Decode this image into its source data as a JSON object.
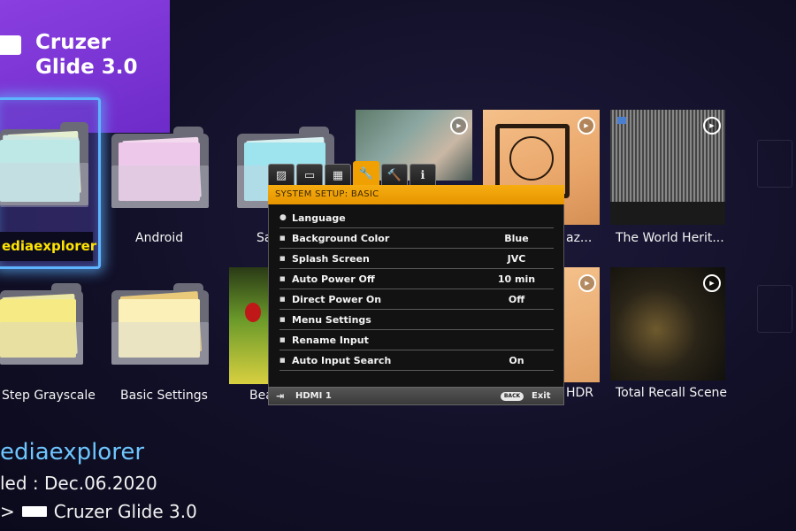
{
  "device": {
    "name": "Cruzer Glide 3.0",
    "icon": "usb-drive-icon"
  },
  "grid": {
    "folders": [
      {
        "label": "ediaexplorer",
        "selected": true,
        "sheet_colors": [
          "#e6eed0",
          "#cfe6e0",
          "#bde8e6"
        ]
      },
      {
        "label": "Android",
        "sheet_colors": [
          "#f3d9ee",
          "#eec8ea",
          "#f4e1f0"
        ]
      },
      {
        "label": "Sa",
        "sheet_colors": [
          "#d8f0f0",
          "#c2ecf0",
          "#9ee4ee"
        ]
      },
      {
        "label": "Step Grayscale",
        "sheet_colors": [
          "#ede7a6",
          "#ffe89a",
          "#f6ea85"
        ]
      },
      {
        "label": "Basic Settings",
        "sheet_colors": [
          "#e9c97a",
          "#f4e4a8",
          "#faf0b8"
        ]
      }
    ],
    "videos": [
      {
        "label": "az...",
        "icon": "play-icon"
      },
      {
        "label": "The World Herit...",
        "icon": "play-icon"
      },
      {
        "label": "Bea",
        "icon": "play-icon"
      },
      {
        "label": "HDR",
        "icon": "play-icon"
      },
      {
        "label": "Total Recall Scene",
        "icon": "play-icon"
      }
    ]
  },
  "info": {
    "title": "ediaexplorer",
    "date": "led : Dec.06.2020",
    "path_prefix": ">",
    "path_device": "Cruzer Glide 3.0"
  },
  "osd": {
    "tabs": [
      {
        "icon": "picture-icon",
        "glyph": "▨"
      },
      {
        "icon": "screen-icon",
        "glyph": "▭"
      },
      {
        "icon": "keyboard-icon",
        "glyph": "▦"
      },
      {
        "icon": "wrench-icon",
        "glyph": "🔧",
        "active": true
      },
      {
        "icon": "advanced-wrench-icon",
        "glyph": "🔨"
      },
      {
        "icon": "info-icon",
        "glyph": "ℹ"
      }
    ],
    "header": "SYSTEM SETUP: BASIC",
    "rows": [
      {
        "label": "Language",
        "value": ""
      },
      {
        "label": "Background Color",
        "value": "Blue"
      },
      {
        "label": "Splash Screen",
        "value": "JVC"
      },
      {
        "label": "Auto Power Off",
        "value": "10 min"
      },
      {
        "label": "Direct Power On",
        "value": "Off"
      },
      {
        "label": "Menu Settings",
        "value": ""
      },
      {
        "label": "Rename Input",
        "value": ""
      },
      {
        "label": "Auto Input Search",
        "value": "On"
      }
    ],
    "footer": {
      "input": "HDMI 1",
      "back": "BACK",
      "exit": "Exit"
    },
    "accent": "#f0a000"
  }
}
